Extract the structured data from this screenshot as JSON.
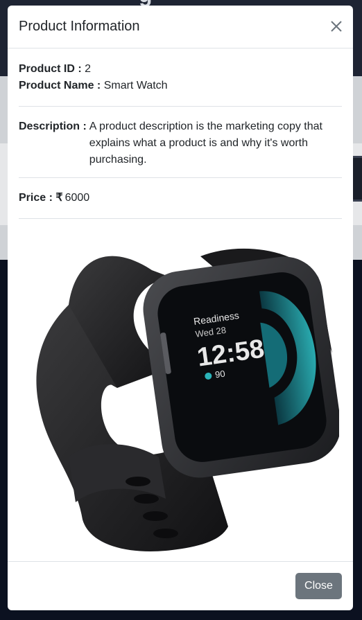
{
  "modal": {
    "title": "Product Information",
    "product_id_label": "Product ID :",
    "product_id": "2",
    "product_name_label": "Product Name :",
    "product_name": "Smart Watch",
    "description_label": "Description :",
    "description": "A product description is the marketing copy that explains what a product is and why it's worth purchasing.",
    "price_label": "Price :",
    "currency_symbol": "₹",
    "price": "6000",
    "close_label": "Close"
  },
  "watch_screen": {
    "readiness": "Readiness",
    "date": "Wed 28",
    "time": "12:58",
    "heart": "90"
  },
  "colors": {
    "close_button": "#6c757d",
    "backdrop": "#0b1120",
    "watch_accent": "#1aa0a8"
  },
  "icons": {
    "close": "close-icon",
    "currency": "rupee-icon"
  }
}
